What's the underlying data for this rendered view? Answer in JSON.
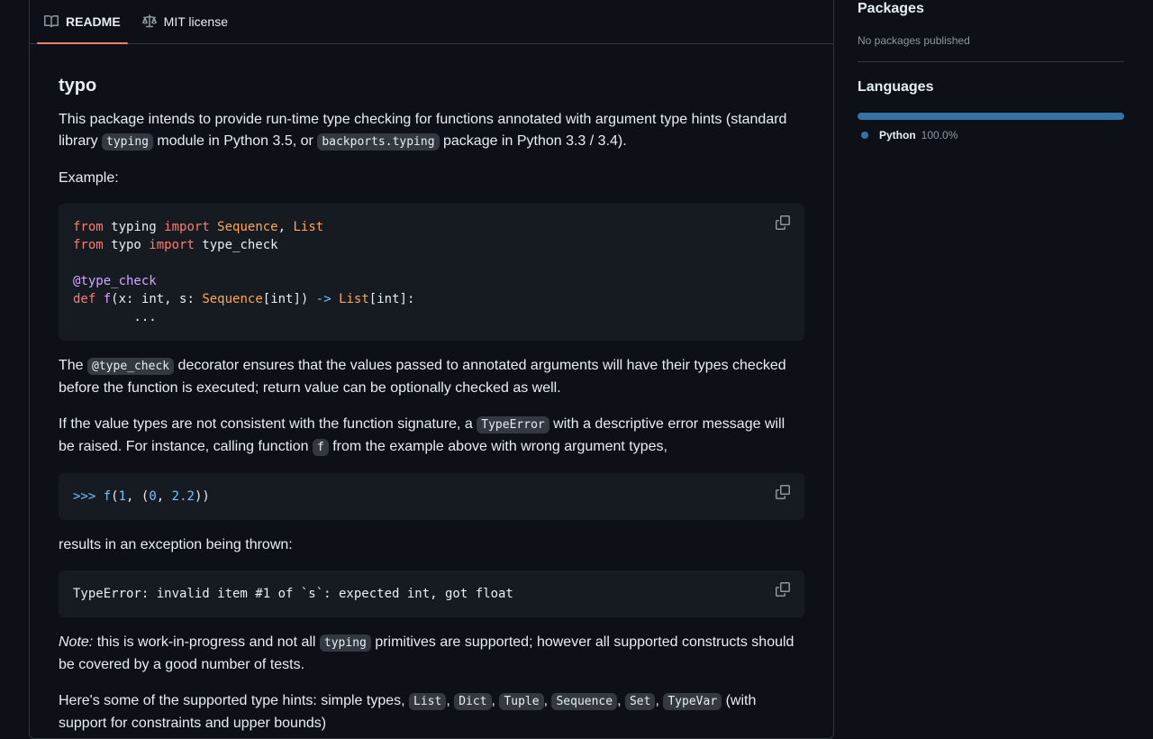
{
  "tabs": [
    {
      "label": "README",
      "icon": "book-icon"
    },
    {
      "label": "MIT license",
      "icon": "law-icon"
    }
  ],
  "readme": {
    "title": "typo",
    "p1": {
      "t1": "This package intends to provide run-time type checking for functions annotated with argument type hints (standard library ",
      "c1": "typing",
      "t2": " module in Python 3.5, or ",
      "c2": "backports.typing",
      "t3": " package in Python 3.3 / 3.4)."
    },
    "example_label": "Example:",
    "code1": {
      "l1": {
        "a": "from",
        "b": " typing ",
        "c": "import",
        "d": " ",
        "e": "Sequence",
        "f": ", ",
        "g": "List"
      },
      "l2": {
        "a": "from",
        "b": " typo ",
        "c": "import",
        "d": " type_check"
      },
      "l4": "@type_check",
      "l5": {
        "a": "def",
        "b": " ",
        "c": "f",
        "d": "(x: int, s: ",
        "e": "Sequence",
        "f": "[int]) ",
        "g": "->",
        "h": " ",
        "i": "List",
        "j": "[int]:"
      },
      "l6": "        ..."
    },
    "p2": {
      "t1": "The ",
      "c1": "@type_check",
      "t2": " decorator ensures that the values passed to annotated arguments will have their types checked before the function is executed; return value can be optionally checked as well."
    },
    "p3": {
      "t1": "If the value types are not consistent with the function signature, a ",
      "c1": "TypeError",
      "t2": " with a descriptive error message will be raised. For instance, calling function ",
      "c2": "f",
      "t3": " from the example above with wrong argument types,"
    },
    "code2": {
      "prompt": ">>>",
      "sp": " ",
      "fn": "f",
      "o": "(",
      "n1": "1",
      "m1": ", (",
      "n2": "0",
      "m2": ", ",
      "n3": "2.2",
      "e": "))"
    },
    "p4": "results in an exception being thrown:",
    "code3": "TypeError: invalid item #1 of `s`: expected int, got float",
    "p5": {
      "em": "Note:",
      "t1": " this is work-in-progress and not all ",
      "c1": "typing",
      "t2": " primitives are supported; however all supported constructs should be covered by a good number of tests."
    },
    "p6": {
      "t1": "Here's some of the supported type hints: simple types, ",
      "c1": "List",
      "s1": ", ",
      "c2": "Dict",
      "s2": ", ",
      "c3": "Tuple",
      "s3": ", ",
      "c4": "Sequence",
      "s4": ", ",
      "c5": "Set",
      "s5": ", ",
      "c6": "TypeVar",
      "t2": " (with support for constraints and upper bounds)"
    }
  },
  "sidebar": {
    "packages_title": "Packages",
    "packages_text": "No packages published",
    "languages_title": "Languages",
    "language": {
      "name": "Python",
      "percent": "100.0%",
      "color": "#3572a5",
      "share": 1.0
    }
  },
  "colors": {
    "accent": "#f78166",
    "background": "#0d1117",
    "border": "#30363d"
  }
}
